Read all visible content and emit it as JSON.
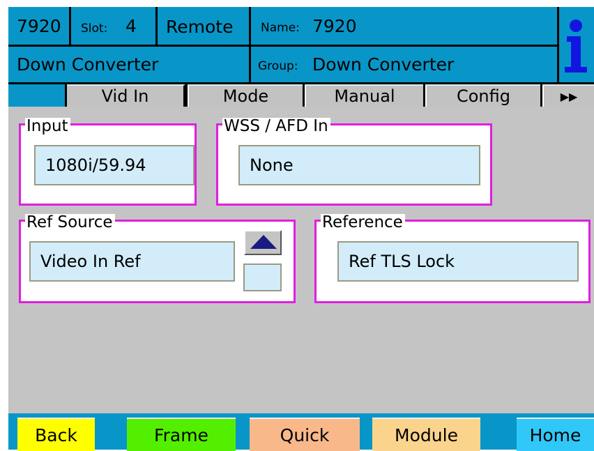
{
  "header": {
    "device_id": "7920",
    "slot_label": "Slot:",
    "slot_value": "4",
    "mode": "Remote",
    "name_label": "Name:",
    "name_value": "7920",
    "module_type": "Down Converter",
    "group_label": "Group:",
    "group_value": "Down Converter",
    "info_icon": "info-icon"
  },
  "tabs": [
    {
      "label": "Vid In"
    },
    {
      "label": "Mode"
    },
    {
      "label": "Manual"
    },
    {
      "label": "Config"
    }
  ],
  "tabs_more_icon": "double-right-arrow-icon",
  "panels": {
    "input": {
      "title": "Input",
      "value": "1080i/59.94"
    },
    "wss_afd": {
      "title": "WSS / AFD In",
      "value": "None"
    },
    "ref_source": {
      "title": "Ref Source",
      "value": "Video In Ref",
      "up_icon": "up-arrow-icon"
    },
    "reference": {
      "title": "Reference",
      "value": "Ref TLS Lock"
    }
  },
  "footer": {
    "back": "Back",
    "frame": "Frame",
    "quick": "Quick",
    "module": "Module",
    "home": "Home"
  },
  "colors": {
    "header_bg": "#0896c8",
    "panel_bg": "#c4c4c4",
    "group_border": "#e01ee0",
    "field_bg": "#d2ecfa",
    "back": "#ffff00",
    "frame": "#52f000",
    "quick": "#f8b88a",
    "module": "#fad48c",
    "home": "#30c8f8",
    "footer_bg": "#0896c8"
  }
}
